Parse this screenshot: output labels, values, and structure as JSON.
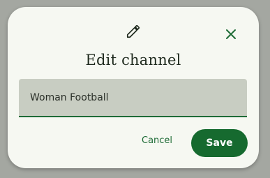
{
  "dialog": {
    "title": "Edit channel",
    "header_icon": "pencil-icon",
    "close_icon": "close-icon",
    "channel_name_value": "Woman Football",
    "cancel_label": "Cancel",
    "save_label": "Save"
  },
  "colors": {
    "accent": "#166a2f",
    "dialog_background": "#f6f8f2",
    "field_background": "#c8cdc2",
    "overlay": "#a4a7a1"
  }
}
